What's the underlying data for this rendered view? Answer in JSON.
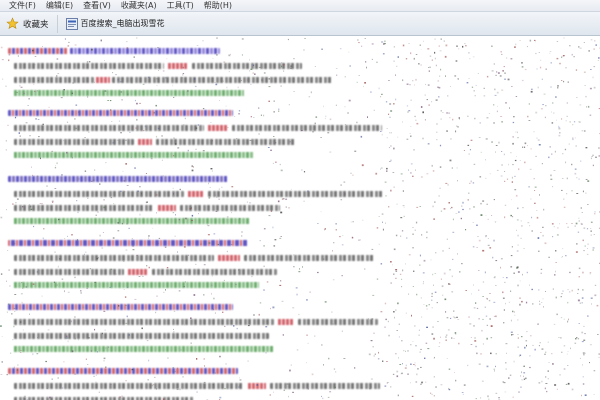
{
  "menubar": {
    "items": [
      {
        "label": "文件(F)"
      },
      {
        "label": "编辑(E)"
      },
      {
        "label": "查看(V)"
      },
      {
        "label": "收藏夹(A)"
      },
      {
        "label": "工具(T)"
      },
      {
        "label": "帮助(H)"
      }
    ]
  },
  "favorites_bar": {
    "favorites_label": "收藏夹",
    "tab_title": "百度搜索_电脑出现雪花",
    "icons": {
      "favorites": "star-icon",
      "tab": "page-icon"
    }
  },
  "colors": {
    "link": "#1a0dab",
    "url": "#2e8b2e",
    "highlight": "#c0232f",
    "toolbar_bg": "#e7ebf1"
  }
}
